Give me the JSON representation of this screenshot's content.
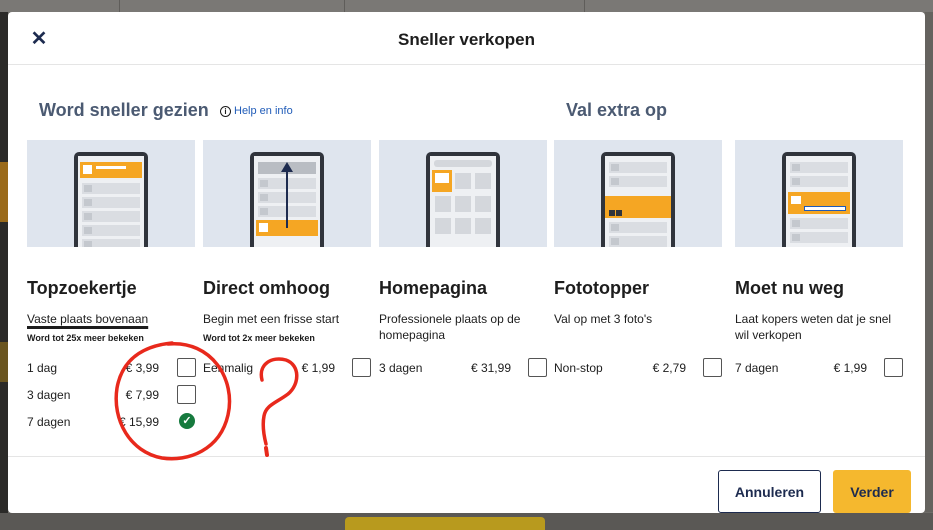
{
  "modal": {
    "title": "Sneller verkopen",
    "close_icon": "close-icon"
  },
  "sections": {
    "left_title": "Word sneller gezien",
    "help_label": "Help en info",
    "right_title": "Val extra op"
  },
  "cards": [
    {
      "title": "Topzoekertje",
      "desc": "Vaste plaats bovenaan",
      "sub": "Word tot 25x meer bekeken",
      "options": [
        {
          "label": "1 dag",
          "price": "€ 3,99",
          "checked": false
        },
        {
          "label": "3 dagen",
          "price": "€ 7,99",
          "checked": false
        },
        {
          "label": "7 dagen",
          "price": "€ 15,99",
          "checked": true
        }
      ]
    },
    {
      "title": "Direct omhoog",
      "desc": "Begin met een frisse start",
      "sub": "Word tot 2x meer bekeken",
      "options": [
        {
          "label": "Eenmalig",
          "price": "€ 1,99",
          "checked": false
        }
      ]
    },
    {
      "title": "Homepagina",
      "desc": "Professionele plaats op de homepagina",
      "sub": "",
      "options": [
        {
          "label": "3 dagen",
          "price": "€ 31,99",
          "checked": false
        }
      ]
    },
    {
      "title": "Fototopper",
      "desc": "Val op met 3 foto's",
      "sub": "",
      "options": [
        {
          "label": "Non-stop",
          "price": "€ 2,79",
          "checked": false
        }
      ]
    },
    {
      "title": "Moet nu weg",
      "desc": "Laat kopers weten dat je snel wil verkopen",
      "sub": "",
      "options": [
        {
          "label": "7 dagen",
          "price": "€ 1,99",
          "checked": false
        }
      ]
    }
  ],
  "footer": {
    "cancel_label": "Annuleren",
    "next_label": "Verder"
  },
  "annotation": {
    "mark": "?",
    "color": "#e8291c"
  },
  "colors": {
    "accent": "#f5b82e",
    "navy": "#1d2b4f",
    "section_title": "#4b5a72",
    "link": "#1f5bb8",
    "check_green": "#167a3e",
    "illustration_bg": "#dfe5ee",
    "illustration_highlight": "#f5a623"
  }
}
